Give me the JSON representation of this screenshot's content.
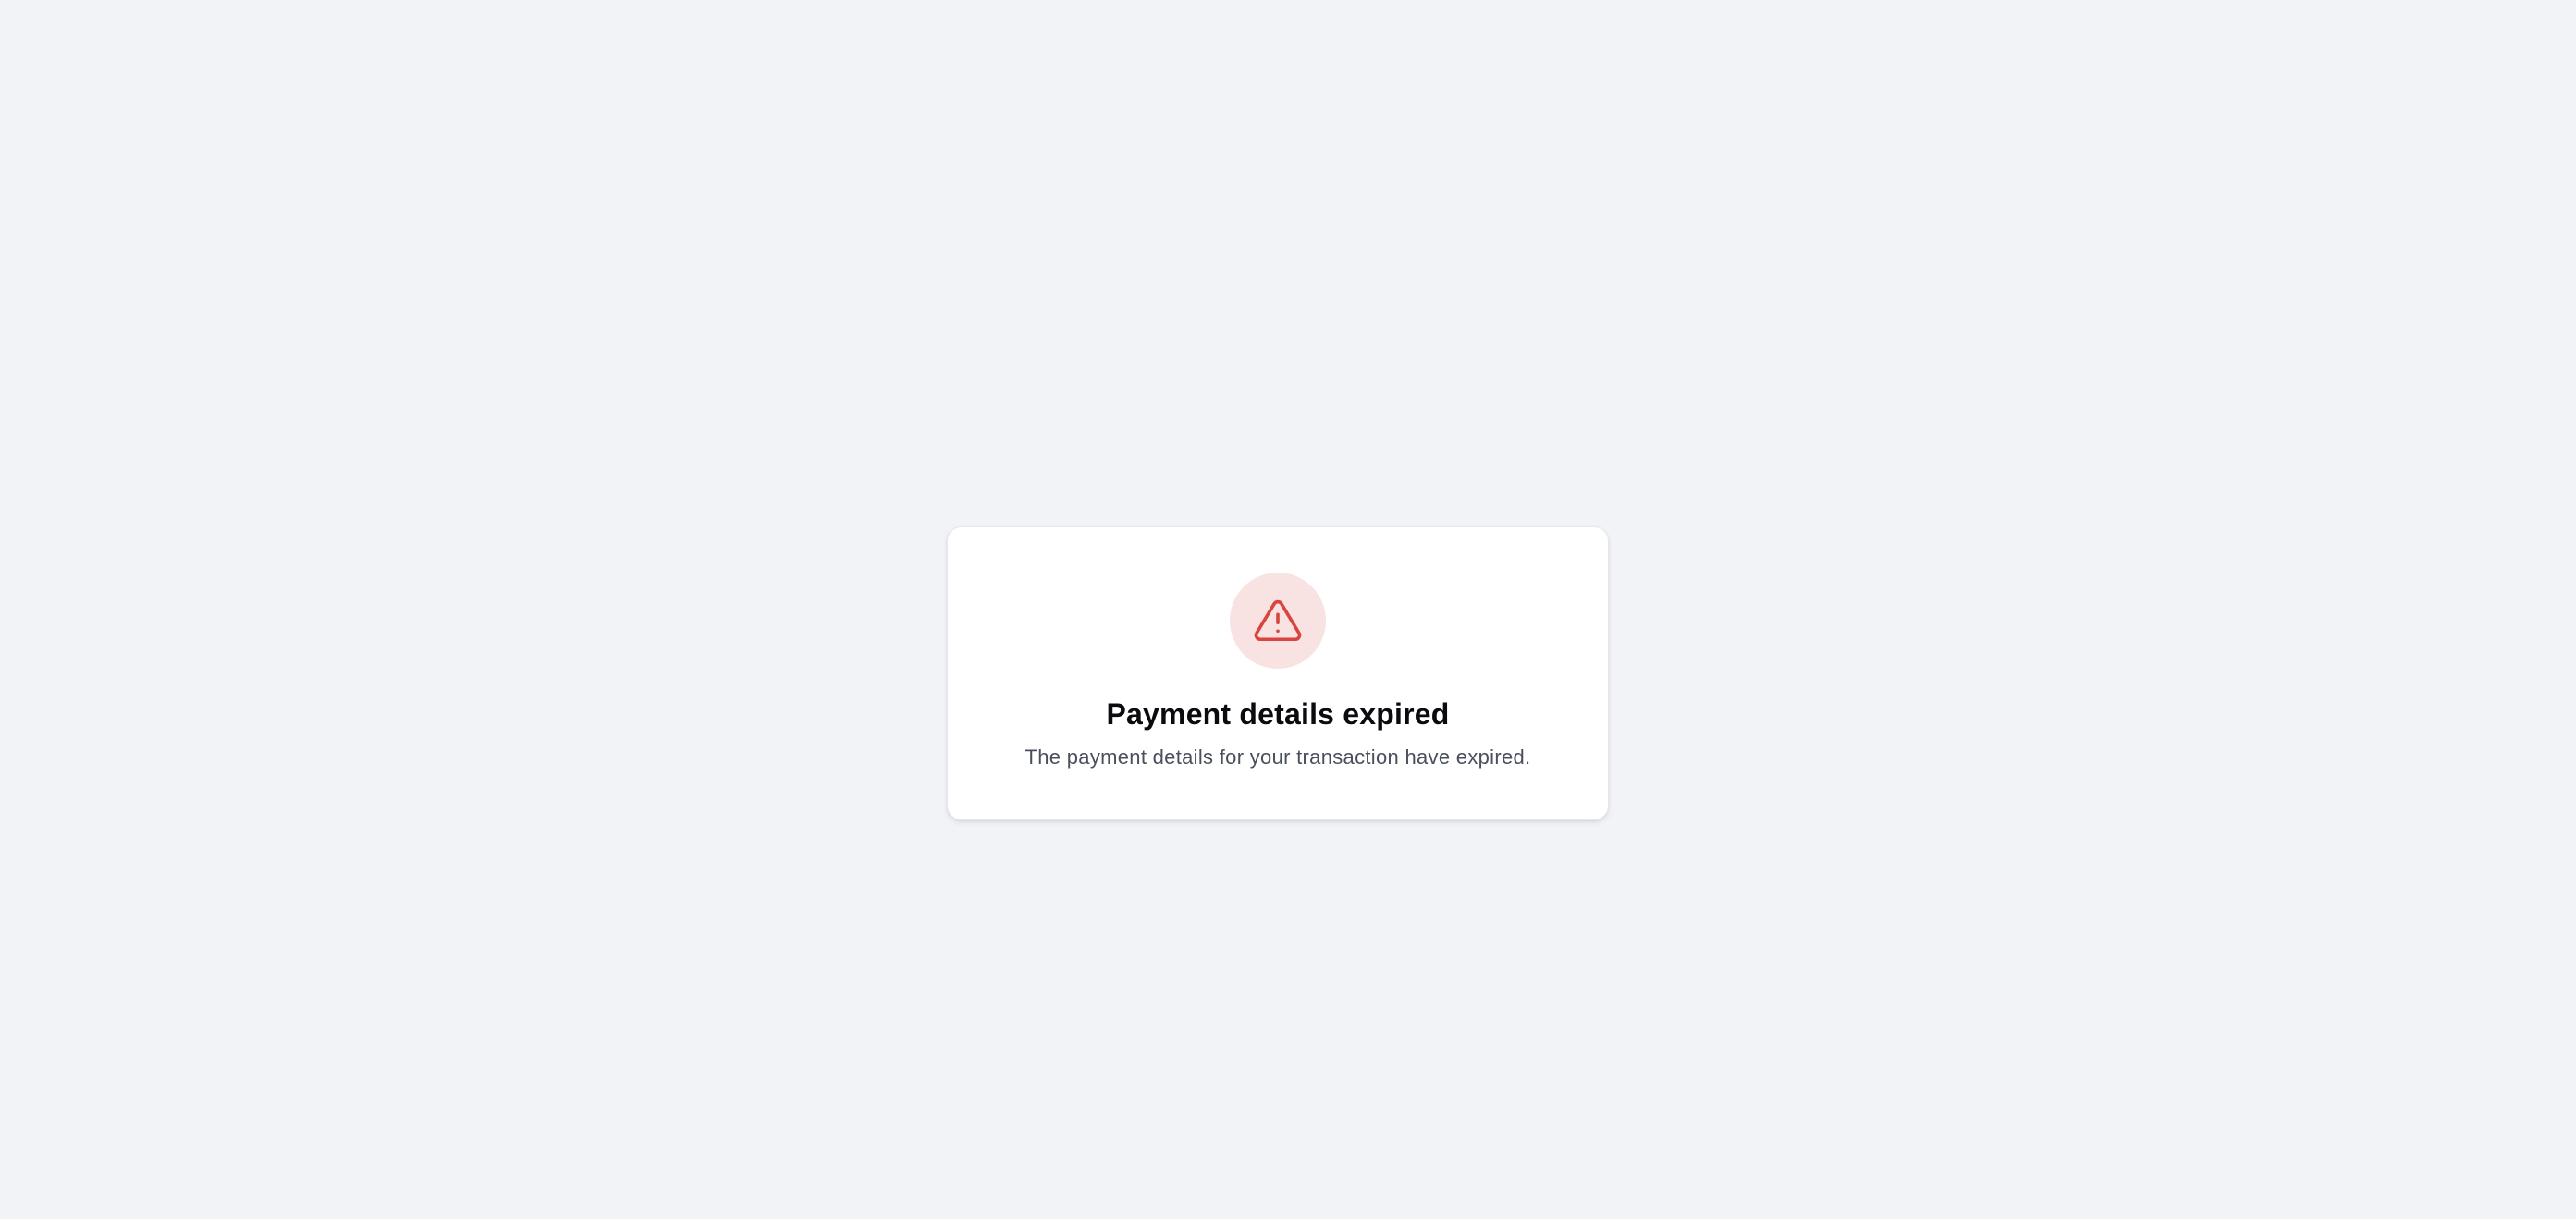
{
  "status_card": {
    "icon": "warning-triangle-icon",
    "title": "Payment details expired",
    "message": "The payment details for your transaction have expired."
  },
  "colors": {
    "page_background": "#f2f3f7",
    "card_background": "#ffffff",
    "icon_background": "#f9e2e2",
    "icon_color": "#d9443f",
    "title_color": "#0b0b0f",
    "message_color": "#4a4f5c"
  }
}
